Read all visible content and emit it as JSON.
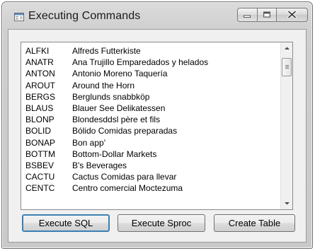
{
  "window": {
    "title": "Executing Commands",
    "icon": "application-icon",
    "caption_buttons": [
      "minimize-icon",
      "maximize-icon",
      "close-icon"
    ]
  },
  "customers": [
    {
      "id": "ALFKI",
      "name": "Alfreds Futterkiste"
    },
    {
      "id": "ANATR",
      "name": "Ana Trujillo Emparedados y helados"
    },
    {
      "id": "ANTON",
      "name": "Antonio Moreno Taquería"
    },
    {
      "id": "AROUT",
      "name": "Around the Horn"
    },
    {
      "id": "BERGS",
      "name": "Berglunds snabbköp"
    },
    {
      "id": "BLAUS",
      "name": "Blauer See Delikatessen"
    },
    {
      "id": "BLONP",
      "name": "Blondesddsl père et fils"
    },
    {
      "id": "BOLID",
      "name": "Bólido Comidas preparadas"
    },
    {
      "id": "BONAP",
      "name": "Bon app'"
    },
    {
      "id": "BOTTM",
      "name": "Bottom-Dollar Markets"
    },
    {
      "id": "BSBEV",
      "name": "B's Beverages"
    },
    {
      "id": "CACTU",
      "name": "Cactus Comidas para llevar"
    },
    {
      "id": "CENTC",
      "name": "Centro comercial Moctezuma"
    }
  ],
  "buttons": {
    "execute_sql": "Execute SQL",
    "execute_sproc": "Execute Sproc",
    "create_table": "Create Table"
  }
}
